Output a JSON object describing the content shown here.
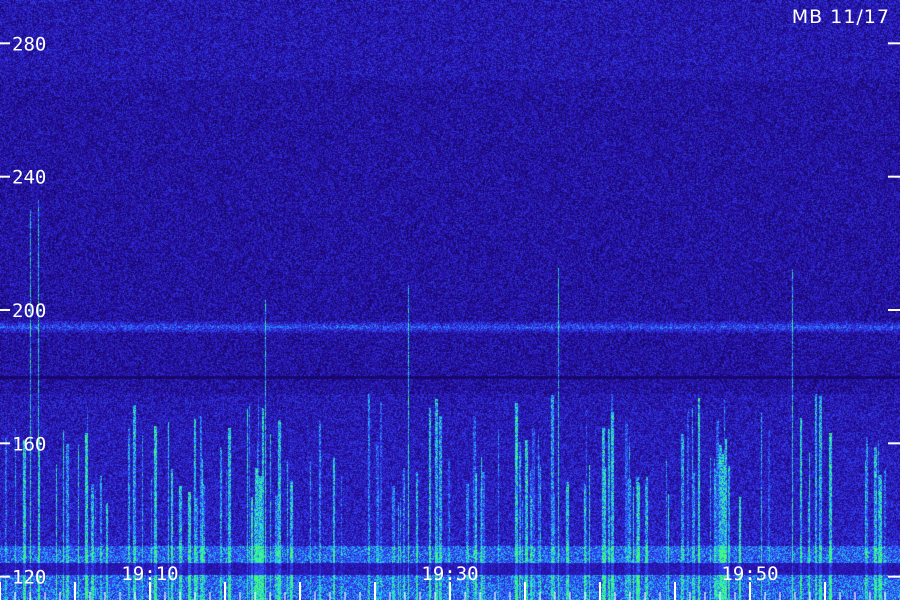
{
  "chart_data": {
    "type": "heatmap",
    "title": "",
    "station_label": "MB 11/17",
    "xlabel": "",
    "ylabel": "",
    "x_ticks": [
      "19:10",
      "19:30",
      "19:50"
    ],
    "x_range": [
      "19:00",
      "19:59"
    ],
    "y_ticks": [
      120,
      160,
      200,
      240,
      280
    ],
    "y_range": [
      113,
      293
    ],
    "grid": false,
    "features": {
      "horizontal_band_value": 195,
      "dark_band_value": 180,
      "burst_floor_value": 113,
      "burst_ceiling_value": 175
    },
    "colors": {
      "background": "#1a0a6e",
      "low": "#2a12a8",
      "mid": "#2f4dff",
      "high": "#1fd7e8",
      "peak": "#39ff7a",
      "text": "#ffffff"
    }
  }
}
